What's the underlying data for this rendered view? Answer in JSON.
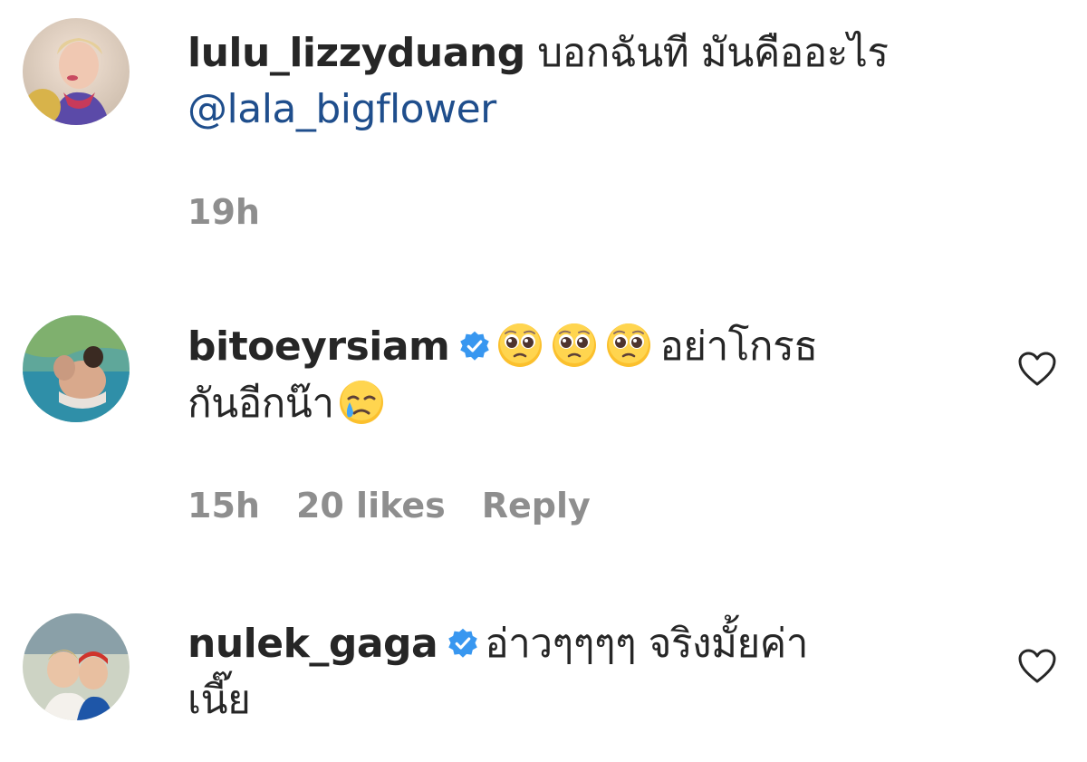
{
  "comments": [
    {
      "username": "lulu_lizzyduang",
      "text": "บอกฉันที มันคืออะไร",
      "mention": "@lala_bigflower",
      "time": "19h",
      "verified": false
    },
    {
      "username": "bitoeyrsiam",
      "text_part1": "อย่าโกรธ",
      "text_part2": "กันอีกน๊า",
      "emojis": [
        "pleading-face-emoji",
        "pleading-face-emoji",
        "pleading-face-emoji",
        "crying-face-emoji"
      ],
      "time": "15h",
      "likes": "20 likes",
      "reply": "Reply",
      "verified": true
    },
    {
      "username": "nulek_gaga",
      "text_part1": "อ่าวๆๆๆๆ จริงมั้ยค่า",
      "text_part2": "เนี๊ย",
      "verified": true
    }
  ],
  "colors": {
    "username": "#262626",
    "mention": "#1f4e8c",
    "meta": "#8e8e8e",
    "verified": "#3897f0"
  },
  "icons": [
    "heart-outline-icon",
    "verified-badge-icon"
  ]
}
